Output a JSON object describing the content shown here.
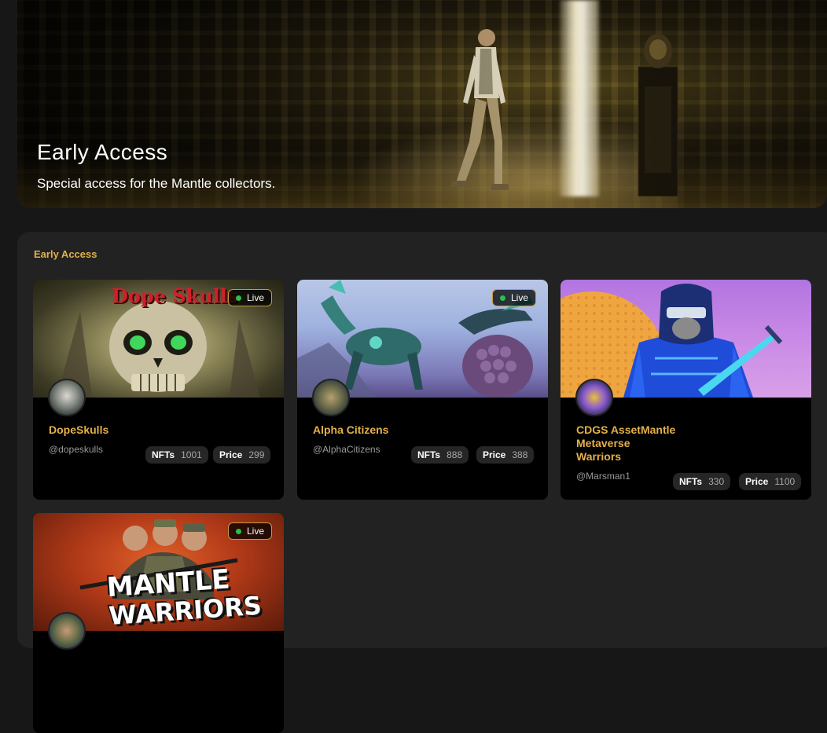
{
  "hero": {
    "title": "Early Access",
    "subtitle": "Special access for the Mantle collectors."
  },
  "section": {
    "title": "Early Access"
  },
  "status_label": "Live",
  "collections": [
    {
      "name": "DopeSkulls",
      "handle": "@dopeskulls",
      "nfts_label": "NFTs",
      "nfts": "1001",
      "price_label": "Price",
      "price": "299",
      "banner_text": "Dope Skulls"
    },
    {
      "name": "Alpha Citizens",
      "handle": "@AlphaCitizens",
      "nfts_label": "NFTs",
      "nfts": "888",
      "price_label": "Price",
      "price": "388"
    },
    {
      "name": "CDGS AssetMantle Metaverse Warriors",
      "name_lines": [
        "CDGS AssetMantle",
        "Metaverse",
        "Warriors"
      ],
      "handle": "@Marsman1",
      "nfts_label": "NFTs",
      "nfts": "330",
      "price_label": "Price",
      "price": "1100"
    },
    {
      "name": "Mantle Warriors",
      "banner_text_line1": "MANTLE",
      "banner_text_line2": "WARRIORS"
    }
  ],
  "colors": {
    "accent": "#e4b04a",
    "live_dot": "#27c24a",
    "background": "#171717",
    "panel": "#222222"
  }
}
